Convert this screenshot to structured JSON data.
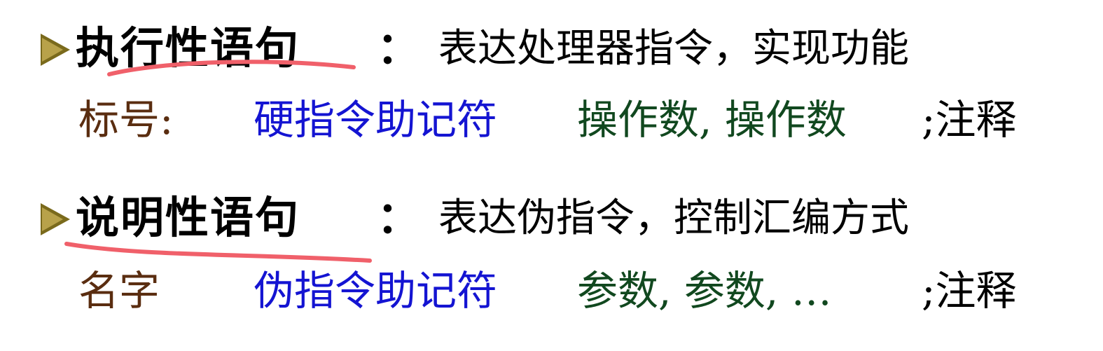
{
  "sections": [
    {
      "heading": "执行性语句",
      "colon": "：",
      "description": "表达处理器指令，实现功能",
      "syntax": {
        "label": "标号:",
        "mnemonic": "硬指令助记符",
        "operands": "操作数, 操作数",
        "comment": ";注释"
      }
    },
    {
      "heading": "说明性语句",
      "colon": "：",
      "description": "表达伪指令，控制汇编方式",
      "syntax": {
        "label": "名字",
        "mnemonic": "伪指令助记符",
        "operands": "参数, 参数, …",
        "comment": ";注释"
      }
    }
  ],
  "colors": {
    "label": "#5a2d10",
    "mnemonic": "#1414d2",
    "operand": "#11481f",
    "underline": "#f0606a",
    "bullet": "#7a6a1c"
  }
}
